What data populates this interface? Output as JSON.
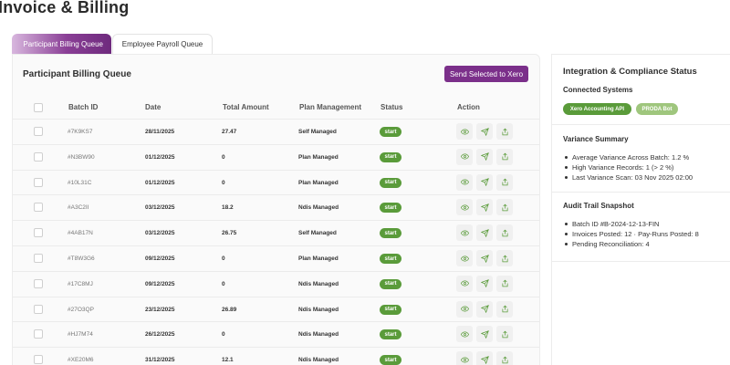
{
  "page": {
    "title": "Invoice & Billing"
  },
  "tabs": [
    {
      "label": "Participant Billing Queue",
      "active": true
    },
    {
      "label": "Employee Payroll Queue",
      "active": false
    }
  ],
  "queue": {
    "title": "Participant Billing Queue",
    "send_button": "Send Selected to Xero",
    "columns": [
      "Batch ID",
      "Date",
      "Total Amount",
      "Plan Management",
      "Status",
      "Action"
    ],
    "rows": [
      {
        "batch": "#7K9KS7",
        "date": "28/11/2025",
        "amount": "27.47",
        "plan": "Self Managed",
        "status": "start"
      },
      {
        "batch": "#N3BW90",
        "date": "01/12/2025",
        "amount": "0",
        "plan": "Plan Managed",
        "status": "start"
      },
      {
        "batch": "#10L31C",
        "date": "01/12/2025",
        "amount": "0",
        "plan": "Plan Managed",
        "status": "start"
      },
      {
        "batch": "#A3C2II",
        "date": "03/12/2025",
        "amount": "18.2",
        "plan": "Ndis Managed",
        "status": "start"
      },
      {
        "batch": "#4AB17N",
        "date": "03/12/2025",
        "amount": "26.75",
        "plan": "Self Managed",
        "status": "start"
      },
      {
        "batch": "#T8W3G6",
        "date": "09/12/2025",
        "amount": "0",
        "plan": "Plan Managed",
        "status": "start"
      },
      {
        "batch": "#17C8MJ",
        "date": "09/12/2025",
        "amount": "0",
        "plan": "Ndis Managed",
        "status": "start"
      },
      {
        "batch": "#27O3QP",
        "date": "23/12/2025",
        "amount": "26.89",
        "plan": "Ndis Managed",
        "status": "start"
      },
      {
        "batch": "#HJ7M74",
        "date": "26/12/2025",
        "amount": "0",
        "plan": "Ndis Managed",
        "status": "start"
      },
      {
        "batch": "#XE20M6",
        "date": "31/12/2025",
        "amount": "12.1",
        "plan": "Ndis Managed",
        "status": "start"
      }
    ],
    "action_icons": [
      "eye-icon",
      "send-icon",
      "export-icon"
    ]
  },
  "side": {
    "title": "Integration & Compliance Status",
    "connected": {
      "heading": "Connected Systems",
      "pills": [
        "Xero Accounting API",
        "PRODA Bot"
      ]
    },
    "variance": {
      "heading": "Variance Summary",
      "items": [
        "Average Variance Across Batch: 1.2 %",
        "High Variance Records: 1 (> 2 %)",
        "Last Variance Scan: 03 Nov 2025 02:00"
      ]
    },
    "audit": {
      "heading": "Audit Trail Snapshot",
      "items": [
        "Batch ID #B-2024-12-13-FIN",
        "Invoices Posted: 12 · Pay-Runs Posted: 8",
        "Pending Reconciliation: 4"
      ]
    }
  },
  "colors": {
    "brand": "#7b2f8a",
    "status_green": "#5a9b3a",
    "pill_light": "#9fc67d"
  }
}
